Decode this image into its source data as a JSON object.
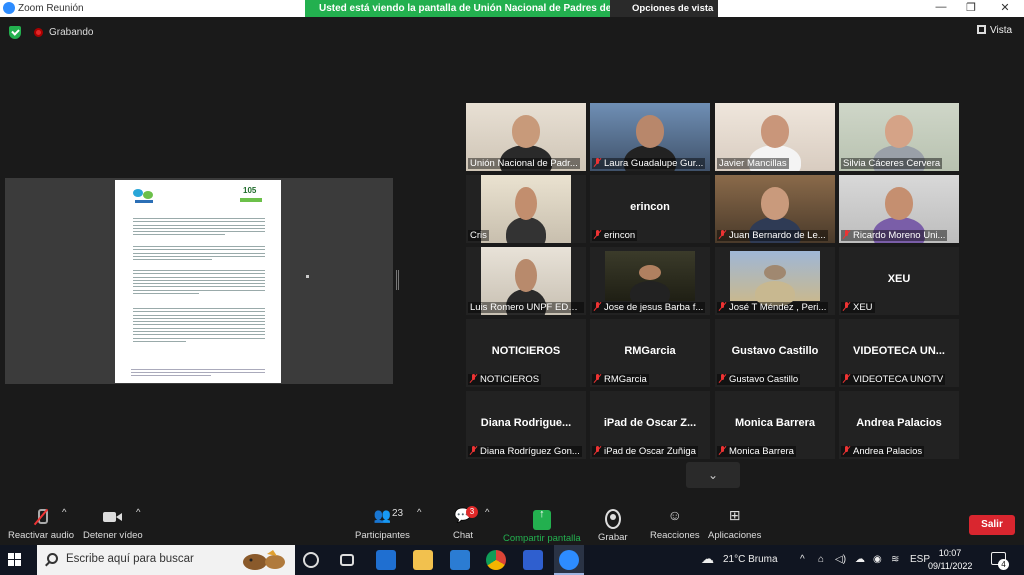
{
  "window": {
    "title": "Zoom Reunión",
    "share_banner": "Usted está viendo la pantalla de Unión Nacional de Padres de Fa...",
    "view_options": "Opciones de vista"
  },
  "top": {
    "recording_label": "Grabando",
    "view_label": "Vista"
  },
  "shared_doc": {
    "page_number": "105"
  },
  "participants": [
    {
      "name": "Unión Nacional de Padr...",
      "muted": false,
      "video": true,
      "center": ""
    },
    {
      "name": "Laura Guadalupe Gur...",
      "muted": true,
      "video": true,
      "center": ""
    },
    {
      "name": "Javier Mancillas",
      "muted": false,
      "video": true,
      "center": ""
    },
    {
      "name": "Silvia Cáceres Cervera",
      "muted": false,
      "video": true,
      "center": "",
      "active": true
    },
    {
      "name": "Cris",
      "muted": false,
      "video": true,
      "center": ""
    },
    {
      "name": "erincon",
      "muted": true,
      "video": false,
      "center": "erincon"
    },
    {
      "name": "Juan Bernardo de Le...",
      "muted": true,
      "video": true,
      "center": ""
    },
    {
      "name": "Ricardo Moreno Uni...",
      "muted": true,
      "video": true,
      "center": ""
    },
    {
      "name": "Luis Romero UNPF EDO...",
      "muted": false,
      "video": true,
      "center": ""
    },
    {
      "name": "Jose de jesus Barba f...",
      "muted": true,
      "video": true,
      "center": ""
    },
    {
      "name": "José T Méndez , Peri...",
      "muted": true,
      "video": true,
      "center": ""
    },
    {
      "name": "XEU",
      "muted": true,
      "video": false,
      "center": "XEU"
    },
    {
      "name": "NOTICIEROS",
      "muted": true,
      "video": false,
      "center": "NOTICIEROS"
    },
    {
      "name": "RMGarcia",
      "muted": true,
      "video": false,
      "center": "RMGarcia"
    },
    {
      "name": "Gustavo Castillo",
      "muted": true,
      "video": false,
      "center": "Gustavo Castillo"
    },
    {
      "name": "VIDEOTECA UNOTV",
      "muted": true,
      "video": false,
      "center": "VIDEOTECA UN..."
    },
    {
      "name": "Diana Rodríguez Gon...",
      "muted": true,
      "video": false,
      "center": "Diana Rodrigue..."
    },
    {
      "name": "iPad de Oscar Zuñiga",
      "muted": true,
      "video": false,
      "center": "iPad de Oscar Z..."
    },
    {
      "name": "Monica Barrera",
      "muted": true,
      "video": false,
      "center": "Monica Barrera"
    },
    {
      "name": "Andrea Palacios",
      "muted": true,
      "video": false,
      "center": "Andrea Palacios"
    }
  ],
  "controls": {
    "audio": "Reactivar audio",
    "video": "Detener vídeo",
    "participants": "Participantes",
    "participants_count": "23",
    "chat": "Chat",
    "chat_badge": "3",
    "share": "Compartir pantalla",
    "record": "Grabar",
    "reactions": "Reacciones",
    "apps": "Aplicaciones",
    "exit": "Salir"
  },
  "taskbar": {
    "search_placeholder": "Escribe aquí para buscar",
    "weather": "21°C Bruma",
    "language": "ESP",
    "time": "10:07",
    "date": "09/11/2022",
    "notifications": "4"
  },
  "colors": {
    "zoom_blue": "#2d8cff",
    "share_green": "#23b04f",
    "mute_red": "#e33333",
    "active_speaker": "#e4e552",
    "exit_red": "#d9262f"
  }
}
